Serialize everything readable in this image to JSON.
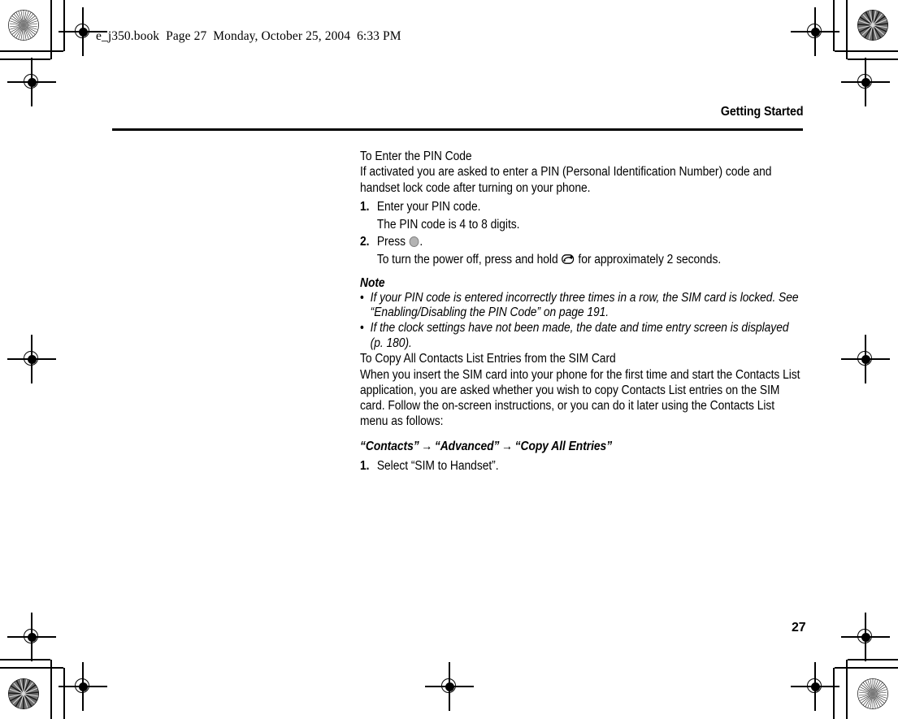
{
  "document": {
    "file_header": "e_j350.book  Page 27  Monday, October 25, 2004  6:33 PM",
    "running_head": "Getting Started",
    "page_number": "27"
  },
  "content": {
    "section1": {
      "heading": "To Enter the PIN Code",
      "intro": "If activated you are asked to enter a PIN (Personal Identification Number) code and handset lock code after turning on your phone.",
      "steps": [
        {
          "number": "1.",
          "text": "Enter your PIN code.",
          "sub": "The PIN code is 4 to 8 digits."
        },
        {
          "number": "2.",
          "text_before_icon": "Press",
          "icon": "center-select-key-icon",
          "text_after_icon": ".",
          "sub_before_icon": "To turn the power off, press and hold",
          "sub_icon": "end-power-key-icon",
          "sub_after_icon": "for approximately 2 seconds."
        }
      ]
    },
    "note": {
      "heading": "Note",
      "bullet_char": "•",
      "items": [
        "If your PIN code is entered incorrectly three times in a row, the SIM card is locked. See “Enabling/Disabling the PIN Code” on page 191.",
        "If the clock settings have not been made, the date and time entry screen is displayed (p. 180)."
      ]
    },
    "section2": {
      "heading": "To Copy All Contacts List Entries from the SIM Card",
      "intro": "When you insert the SIM card into your phone for the first time and start the Contacts List application, you are asked whether you wish to copy Contacts List entries on the SIM card. Follow the on-screen instructions, or you can do it later using the Contacts List menu as follows:",
      "nav_path": {
        "item1": "“Contacts”",
        "arrow1": "→",
        "item2": "“Advanced”",
        "arrow2": "→",
        "item3": "“Copy All Entries”"
      },
      "steps": [
        {
          "number": "1.",
          "text": "Select “SIM to Handset”."
        }
      ]
    }
  }
}
